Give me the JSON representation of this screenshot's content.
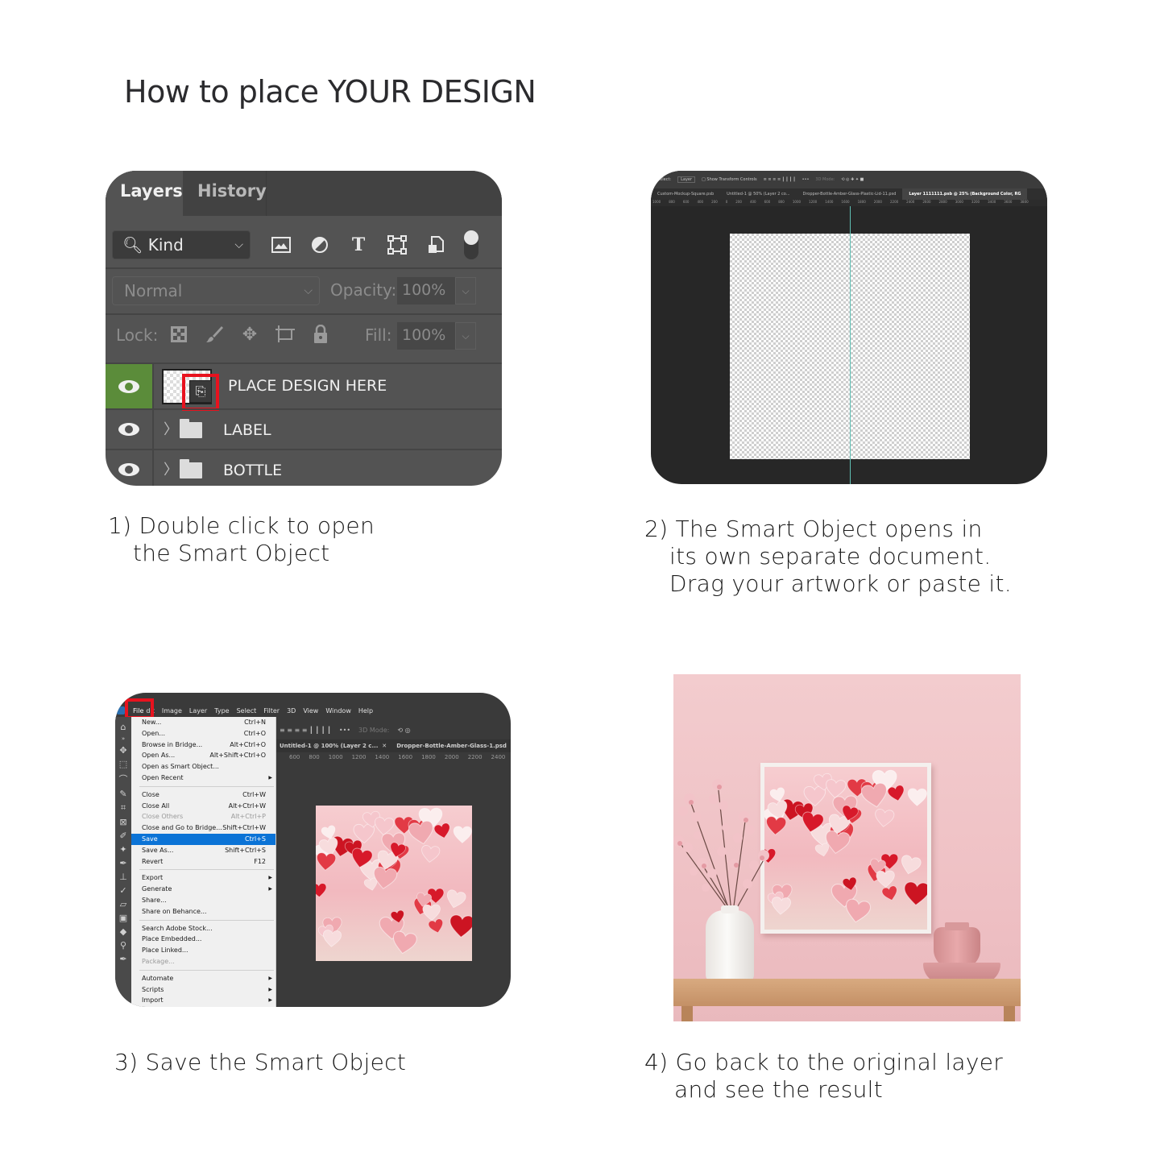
{
  "title": {
    "prefix": "How to place ",
    "emphasis": "YOUR DESIGN"
  },
  "step1": {
    "caption_line1": "1) Double click to open",
    "caption_line2": "the Smart Object",
    "panel": {
      "tabs": [
        "Layers",
        "History"
      ],
      "filter": {
        "label": "Kind",
        "icon": "search-icon"
      },
      "filter_icons": [
        "image-filter-icon",
        "adjustment-filter-icon",
        "type-filter-icon",
        "shape-filter-icon",
        "smart-object-filter-icon"
      ],
      "blend_mode": "Normal",
      "opacity_label": "Opacity:",
      "opacity_value": "100%",
      "lock_label": "Lock:",
      "lock_icons": [
        "lock-transparent-pixels-icon",
        "lock-image-pixels-icon",
        "lock-position-icon",
        "lock-artboard-icon",
        "lock-all-icon"
      ],
      "fill_label": "Fill:",
      "fill_value": "100%",
      "layers": [
        {
          "name": "PLACE DESIGN HERE",
          "type": "smart-object",
          "visible": true,
          "selected": true
        },
        {
          "name": "LABEL",
          "type": "group",
          "visible": true,
          "selected": false
        },
        {
          "name": "BOTTLE",
          "type": "group",
          "visible": true,
          "selected": false
        }
      ]
    }
  },
  "step2": {
    "caption_line1": "2) The Smart Object opens in",
    "caption_line2": "its own separate document.",
    "caption_line3": "Drag your artwork or paste it.",
    "panel": {
      "options": {
        "auto_select_label": "Select:",
        "auto_select_value": "Layer",
        "transform_label": "Show Transform Controls",
        "mode_label": "3D Mode:"
      },
      "doc_tabs": [
        "Custom-Mockup-Square.psb",
        "Untitled-1 @ 50% (Layer 2 co...",
        "Dropper-Bottle-Amber-Glass-Plastic-Lid-11.psd",
        "Layer 1111111.psb @ 25% (Background Color, RG"
      ],
      "active_tab_index": 3,
      "ruler": [
        "1000",
        "800",
        "600",
        "400",
        "200",
        "0",
        "200",
        "400",
        "600",
        "800",
        "1000",
        "1200",
        "1400",
        "1600",
        "1800",
        "2000",
        "2200",
        "2400",
        "2600",
        "2800",
        "3000",
        "3200",
        "3400",
        "3600",
        "3800"
      ]
    }
  },
  "step3": {
    "caption": "3) Save the Smart Object",
    "panel": {
      "menubar": [
        "File",
        "Edit",
        "Image",
        "Layer",
        "Type",
        "Select",
        "Filter",
        "3D",
        "View",
        "Window",
        "Help"
      ],
      "menubar_display": [
        "File",
        "dit",
        "Image",
        "Layer",
        "Type",
        "Select",
        "Filter",
        "3D",
        "View",
        "Window",
        "Help"
      ],
      "options_label": "3D Mode:",
      "doc_tabs": [
        "Untitled-1 @ 100% (Layer 2 c...",
        "Dropper-Bottle-Amber-Glass-1.psd"
      ],
      "ruler": [
        "600",
        "800",
        "1000",
        "1200",
        "1400",
        "1600",
        "1800",
        "2000",
        "2200",
        "2400"
      ],
      "file_menu": {
        "groups": [
          [
            {
              "label": "New...",
              "shortcut": "Ctrl+N"
            },
            {
              "label": "Open...",
              "shortcut": "Ctrl+O"
            },
            {
              "label": "Browse in Bridge...",
              "shortcut": "Alt+Ctrl+O"
            },
            {
              "label": "Open As...",
              "shortcut": "Alt+Shift+Ctrl+O"
            },
            {
              "label": "Open as Smart Object...",
              "shortcut": ""
            },
            {
              "label": "Open Recent",
              "shortcut": "",
              "submenu": true
            }
          ],
          [
            {
              "label": "Close",
              "shortcut": "Ctrl+W"
            },
            {
              "label": "Close All",
              "shortcut": "Alt+Ctrl+W"
            },
            {
              "label": "Close Others",
              "shortcut": "Alt+Ctrl+P",
              "disabled": true
            },
            {
              "label": "Close and Go to Bridge...",
              "shortcut": "Shift+Ctrl+W"
            },
            {
              "label": "Save",
              "shortcut": "Ctrl+S",
              "selected": true
            },
            {
              "label": "Save As...",
              "shortcut": "Shift+Ctrl+S"
            },
            {
              "label": "Revert",
              "shortcut": "F12"
            }
          ],
          [
            {
              "label": "Export",
              "shortcut": "",
              "submenu": true
            },
            {
              "label": "Generate",
              "shortcut": "",
              "submenu": true
            },
            {
              "label": "Share...",
              "shortcut": ""
            },
            {
              "label": "Share on Behance...",
              "shortcut": ""
            }
          ],
          [
            {
              "label": "Search Adobe Stock...",
              "shortcut": ""
            },
            {
              "label": "Place Embedded...",
              "shortcut": ""
            },
            {
              "label": "Place Linked...",
              "shortcut": ""
            },
            {
              "label": "Package...",
              "shortcut": "",
              "disabled": true
            }
          ],
          [
            {
              "label": "Automate",
              "shortcut": "",
              "submenu": true
            },
            {
              "label": "Scripts",
              "shortcut": "",
              "submenu": true
            },
            {
              "label": "Import",
              "shortcut": "",
              "submenu": true
            }
          ]
        ]
      }
    }
  },
  "step4": {
    "caption_line1": "4) Go back to the original layer",
    "caption_line2": "and see the result"
  },
  "colors": {
    "highlight_red": "#e8121e",
    "layer_selected_green": "#5b8c3a",
    "menu_selected_blue": "#0b73d6",
    "guide_cyan": "#5fc0b5"
  }
}
